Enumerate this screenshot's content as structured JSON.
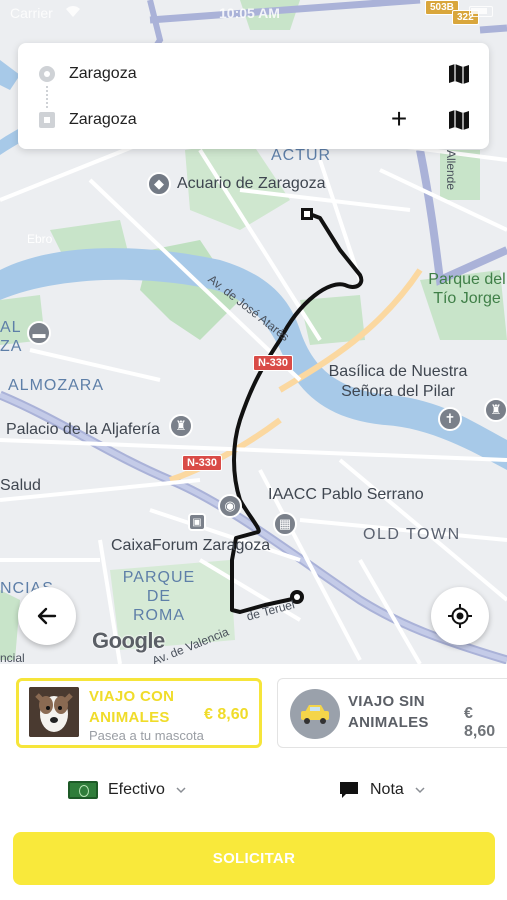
{
  "status_bar": {
    "carrier": "Carrier",
    "time": "10:05 AM"
  },
  "route": {
    "origin": "Zaragoza",
    "destination": "Zaragoza"
  },
  "map": {
    "labels": {
      "actur": "ACTUR",
      "acuario": "Acuario de Zaragoza",
      "ebro": "Ebro",
      "jose_atares": "Av. de José Atarés",
      "parque_tio_jorge": "Parque del Tío Jorge",
      "basilica": "Basílica de Nuestra Señora del Pilar",
      "almozara": "ALMOZARA",
      "al_za": "AL ZA",
      "aljaferia": "Palacio de la Aljafería",
      "salud": "Salud",
      "iaacc": "IAACC Pablo Serrano",
      "old_town": "OLD TOWN",
      "caixaforum": "CaixaForum Zaragoza",
      "parque_roma": "PARQUE DE ROMA",
      "valencia": "Av. de Valencia",
      "teruel": "de Teruel",
      "alfonso_allende": "Allende",
      "ncias": "NCIAS",
      "ncial": "ncial",
      "n330_a": "N-330",
      "n330_b": "N-330",
      "shield_503b": "503B",
      "shield_322": "322",
      "google": "Google"
    }
  },
  "ride_options": [
    {
      "title": "VIAJO CON ANIMALES",
      "price": "€ 8,60",
      "subtitle": "Pasea a tu mascota",
      "selected": true
    },
    {
      "title": "VIAJO SIN ANIMALES",
      "price": "€ 8,60",
      "selected": false
    }
  ],
  "payment": {
    "method": "Efectivo",
    "note": "Nota"
  },
  "request_button": "SOLICITAR",
  "colors": {
    "accent": "#f9e93b",
    "route": "#111111"
  }
}
